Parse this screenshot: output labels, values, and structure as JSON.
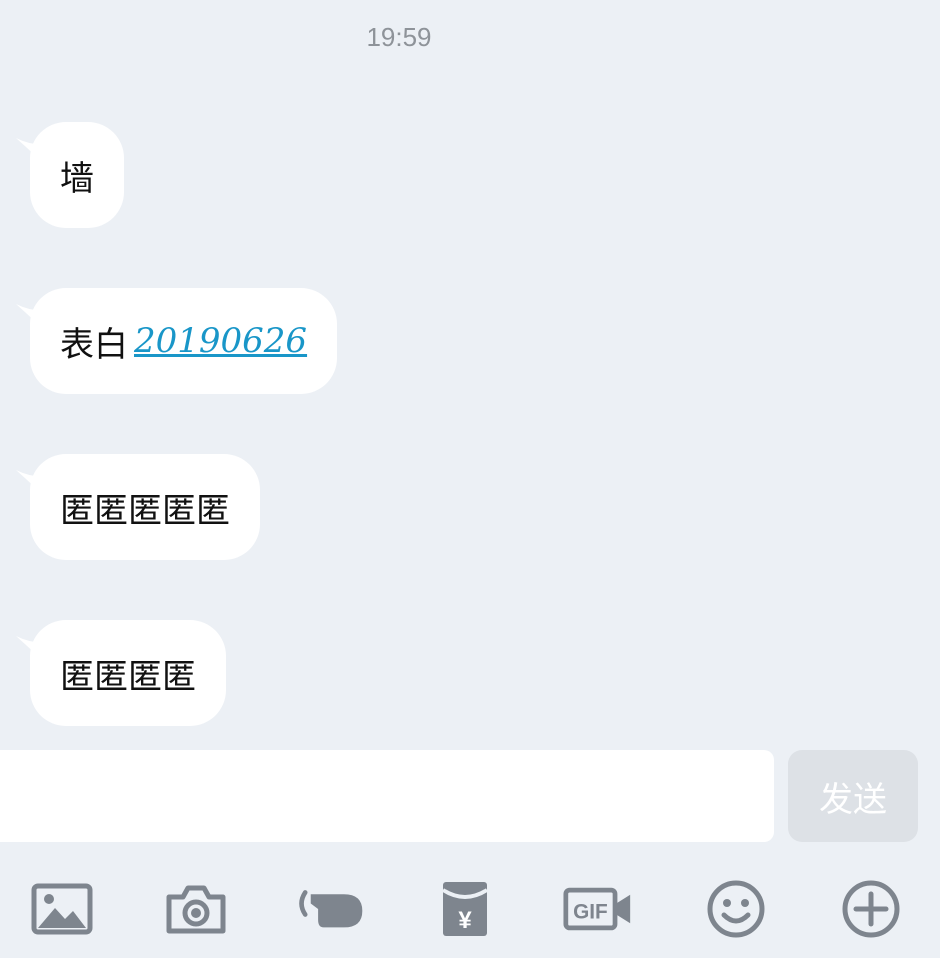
{
  "header": {
    "time": "19:59"
  },
  "messages": [
    {
      "text": "墙",
      "link": ""
    },
    {
      "text": "表白",
      "link": "20190626"
    },
    {
      "text": "匿匿匿匿匿",
      "link": ""
    },
    {
      "text": "匿匿匿匿",
      "link": ""
    }
  ],
  "composer": {
    "input_value": "",
    "send_label": "发送"
  },
  "toolbar": {
    "icons": [
      "image-icon",
      "camera-icon",
      "poke-icon",
      "red-packet-icon",
      "gif-icon",
      "emoji-icon",
      "plus-icon"
    ],
    "gif_text": "GIF",
    "yen_symbol": "¥"
  },
  "colors": {
    "background": "#ecf0f5",
    "bubble": "#ffffff",
    "link": "#1996c8",
    "icon": "#7e858e",
    "send_disabled": "#dde1e6"
  }
}
